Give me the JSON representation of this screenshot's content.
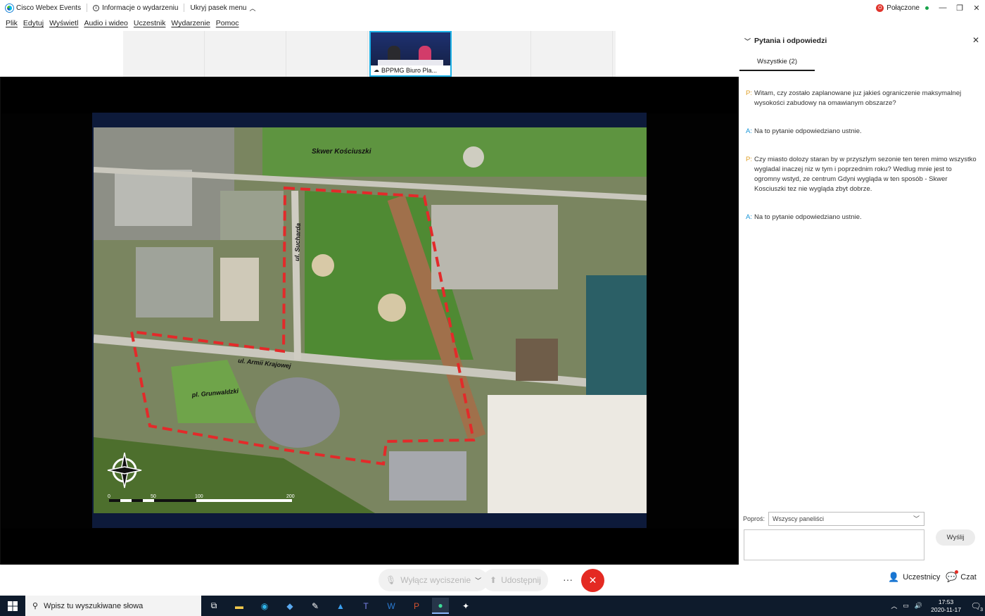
{
  "titlebar": {
    "app_name": "Cisco Webex Events",
    "event_info": "Informacje o wydarzeniu",
    "hide_menu": "Ukryj pasek menu",
    "connection_status": "Połączone",
    "rec_glyph": "O",
    "accent_color": "#1fb3e8"
  },
  "menu": [
    "Plik",
    "Edytuj",
    "Wyświetl",
    "Audio i wideo",
    "Uczestnik",
    "Wydarzenie",
    "Pomoc"
  ],
  "video": {
    "active_speaker_label": "BPPMG Biuro Pla..."
  },
  "map": {
    "labels": {
      "square": "Skwer Kościuszki",
      "street_1": "ul. Sucharda",
      "street_2": "ul. Armii Krajowej",
      "plaza": "pl. Grunwaldzki"
    },
    "scale_ticks": [
      "0",
      "50",
      "100",
      "200"
    ]
  },
  "qa_panel": {
    "title": "Pytania i odpowiedzi",
    "tab_all": "Wszystkie (2)",
    "entries": [
      {
        "tag": "P:",
        "kind": "q",
        "text": "Witam, czy zostało zaplanowane juz jakieś ograniczenie maksymalnej wysokości zabudowy na omawianym obszarze?"
      },
      {
        "tag": "A:",
        "kind": "a",
        "text": "Na to pytanie odpowiedziano ustnie."
      },
      {
        "tag": "P:",
        "kind": "q",
        "text": "Czy miasto dolozy staran by w przyszlym sezonie ten teren mimo wszystko wygladal inaczej niz w tym i poprzednim roku? Wedlug mnie jest to ogromny wstyd, ze centrum Gdyni wygląda w ten sposób - Skwer Kosciuszki tez nie wygląda zbyt dobrze."
      },
      {
        "tag": "A:",
        "kind": "a",
        "text": "Na to pytanie odpowiedziano ustnie."
      }
    ],
    "ask_label": "Poproś:",
    "ask_target": "Wszyscy paneliści",
    "send_label": "Wyślij"
  },
  "controls": {
    "mute_label": "Wyłącz wyciszenie",
    "share_label": "Udostępnij",
    "more_label": "···",
    "end_icon": "✕",
    "participants_label": "Uczestnicy",
    "chat_label": "Czat"
  },
  "taskbar": {
    "search_placeholder": "Wpisz tu wyszukiwane słowa",
    "time": "17:53",
    "date": "2020-11-17",
    "notification_count": "3"
  }
}
